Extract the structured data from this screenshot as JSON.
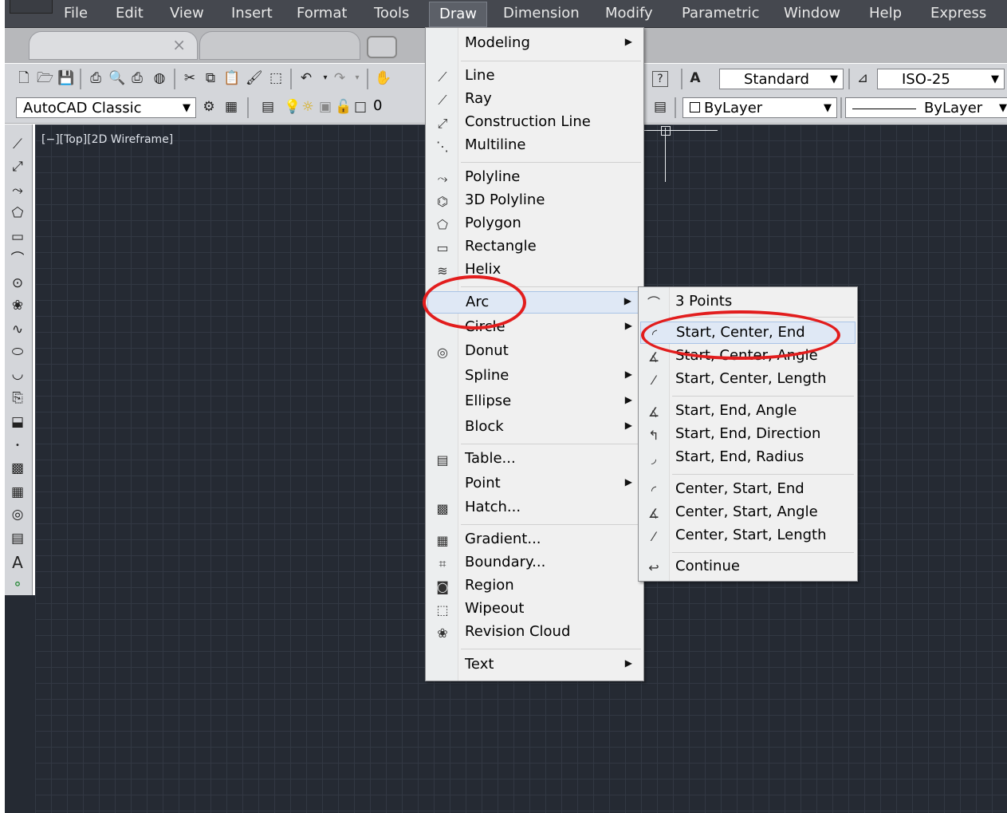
{
  "menubar": {
    "items": [
      "File",
      "Edit",
      "View",
      "Insert",
      "Format",
      "Tools",
      "Draw",
      "Dimension",
      "Modify",
      "Parametric",
      "Window",
      "Help",
      "Express"
    ],
    "active": "Draw"
  },
  "tab": {
    "close": "×"
  },
  "toolbar1": {
    "text_style": "Standard",
    "dim_style": "ISO-25",
    "help": "?"
  },
  "toolbar2": {
    "workspace": "AutoCAD Classic",
    "layer_value": "0",
    "color": "ByLayer",
    "linetype": "ByLayer"
  },
  "viewport_label": "[−][Top][2D Wireframe]",
  "draw_menu": {
    "items": [
      {
        "label": "Modeling",
        "icon": "",
        "sub": true
      },
      {
        "label": "Line",
        "icon": "line-icon"
      },
      {
        "label": "Ray",
        "icon": "ray-icon"
      },
      {
        "label": "Construction Line",
        "icon": "construction-line-icon"
      },
      {
        "label": "Multiline",
        "icon": "multiline-icon"
      },
      {
        "label": "Polyline",
        "icon": "polyline-icon"
      },
      {
        "label": "3D Polyline",
        "icon": "3d-polyline-icon"
      },
      {
        "label": "Polygon",
        "icon": "polygon-icon"
      },
      {
        "label": "Rectangle",
        "icon": "rectangle-icon"
      },
      {
        "label": "Helix",
        "icon": "helix-icon"
      },
      {
        "label": "Arc",
        "icon": "",
        "sub": true
      },
      {
        "label": "Circle",
        "icon": "",
        "sub": true
      },
      {
        "label": "Donut",
        "icon": "donut-icon"
      },
      {
        "label": "Spline",
        "icon": "",
        "sub": true
      },
      {
        "label": "Ellipse",
        "icon": "",
        "sub": true
      },
      {
        "label": "Block",
        "icon": "",
        "sub": true
      },
      {
        "label": "Table...",
        "icon": "table-icon"
      },
      {
        "label": "Point",
        "icon": "",
        "sub": true
      },
      {
        "label": "Hatch...",
        "icon": "hatch-icon"
      },
      {
        "label": "Gradient...",
        "icon": "gradient-icon"
      },
      {
        "label": "Boundary...",
        "icon": "boundary-icon"
      },
      {
        "label": "Region",
        "icon": "region-icon"
      },
      {
        "label": "Wipeout",
        "icon": "wipeout-icon"
      },
      {
        "label": "Revision Cloud",
        "icon": "revision-cloud-icon"
      },
      {
        "label": "Text",
        "icon": "",
        "sub": true
      }
    ],
    "highlighted": "Arc"
  },
  "arc_menu": {
    "items": [
      {
        "label": "3 Points",
        "icon": "arc-3points-icon"
      },
      {
        "label": "Start, Center, End",
        "icon": "arc-sce-icon"
      },
      {
        "label": "Start, Center, Angle",
        "icon": "arc-sca-icon"
      },
      {
        "label": "Start, Center, Length",
        "icon": "arc-scl-icon"
      },
      {
        "label": "Start, End, Angle",
        "icon": "arc-sea-icon"
      },
      {
        "label": "Start, End, Direction",
        "icon": "arc-sed-icon"
      },
      {
        "label": "Start, End, Radius",
        "icon": "arc-ser-icon"
      },
      {
        "label": "Center, Start, End",
        "icon": "arc-cse-icon"
      },
      {
        "label": "Center, Start, Angle",
        "icon": "arc-csa-icon"
      },
      {
        "label": "Center, Start, Length",
        "icon": "arc-csl-icon"
      },
      {
        "label": "Continue",
        "icon": "arc-continue-icon"
      }
    ],
    "highlighted": "Start, Center, End"
  },
  "colors": {
    "annotation": "#e21d1d",
    "canvas": "#252a33",
    "menubar": "#45484f",
    "highlight": "#dfe8f5"
  }
}
